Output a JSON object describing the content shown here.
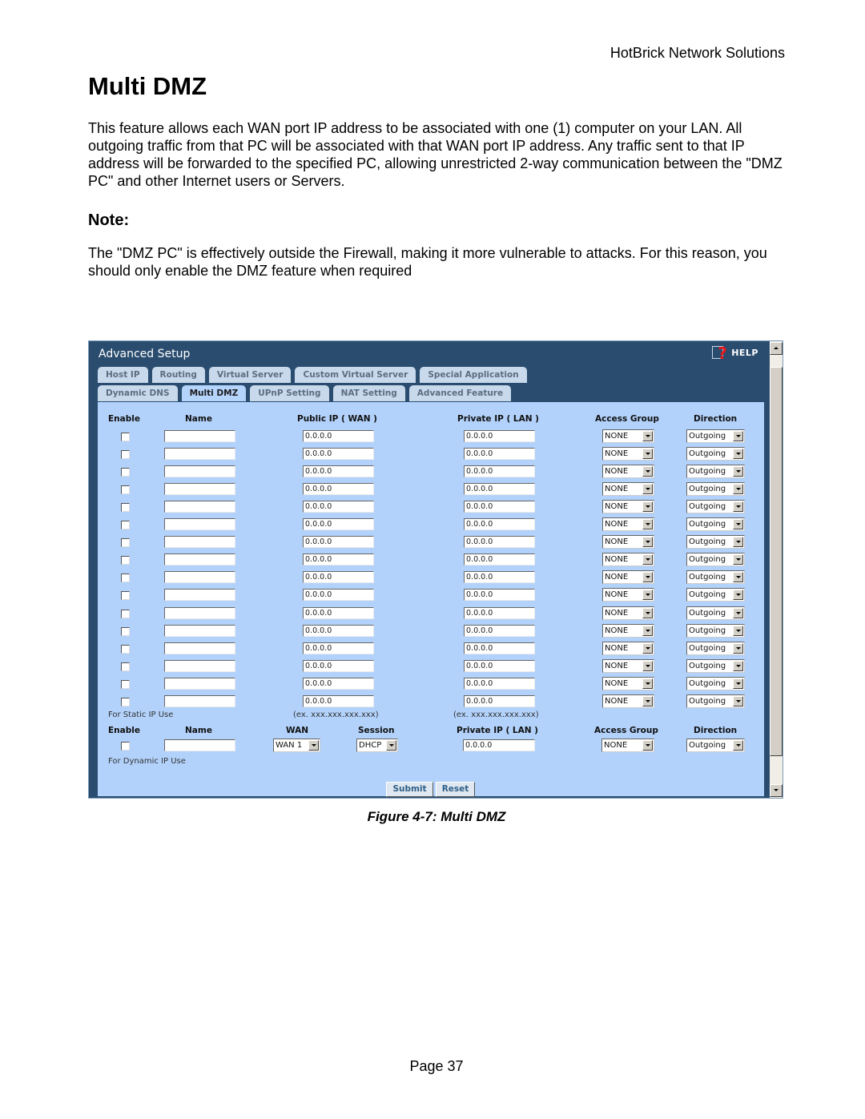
{
  "header": {
    "company": "HotBrick Network Solutions"
  },
  "title": "Multi DMZ",
  "intro": "This feature allows each WAN port IP address to be associated with one (1) computer on your LAN. All outgoing traffic from that PC will be associated with that WAN port IP address. Any traffic sent to that IP address will be forwarded to the specified PC, allowing unrestricted 2-way communication between the \"DMZ PC\" and other Internet users or Servers.",
  "note_heading": "Note:",
  "note_text": "The \"DMZ PC\" is effectively outside the Firewall, making it more vulnerable to attacks. For this reason, you should only enable the DMZ feature when required",
  "figure": {
    "window_title": "Advanced Setup",
    "help_label": "HELP",
    "tabs_row1": [
      "Host IP",
      "Routing",
      "Virtual Server",
      "Custom Virtual Server",
      "Special Application"
    ],
    "tabs_row2": [
      "Dynamic DNS",
      "Multi DMZ",
      "UPnP Setting",
      "NAT Setting",
      "Advanced Feature"
    ],
    "active_tab": "Multi DMZ",
    "static_table": {
      "headers": {
        "enable": "Enable",
        "name": "Name",
        "public_ip": "Public IP ( WAN )",
        "private_ip": "Private IP ( LAN )",
        "access_group": "Access Group",
        "direction": "Direction"
      },
      "rows": [
        {
          "enabled": false,
          "name": "",
          "public_ip": "0.0.0.0",
          "private_ip": "0.0.0.0",
          "access_group": "NONE",
          "direction": "Outgoing"
        },
        {
          "enabled": false,
          "name": "",
          "public_ip": "0.0.0.0",
          "private_ip": "0.0.0.0",
          "access_group": "NONE",
          "direction": "Outgoing"
        },
        {
          "enabled": false,
          "name": "",
          "public_ip": "0.0.0.0",
          "private_ip": "0.0.0.0",
          "access_group": "NONE",
          "direction": "Outgoing"
        },
        {
          "enabled": false,
          "name": "",
          "public_ip": "0.0.0.0",
          "private_ip": "0.0.0.0",
          "access_group": "NONE",
          "direction": "Outgoing"
        },
        {
          "enabled": false,
          "name": "",
          "public_ip": "0.0.0.0",
          "private_ip": "0.0.0.0",
          "access_group": "NONE",
          "direction": "Outgoing"
        },
        {
          "enabled": false,
          "name": "",
          "public_ip": "0.0.0.0",
          "private_ip": "0.0.0.0",
          "access_group": "NONE",
          "direction": "Outgoing"
        },
        {
          "enabled": false,
          "name": "",
          "public_ip": "0.0.0.0",
          "private_ip": "0.0.0.0",
          "access_group": "NONE",
          "direction": "Outgoing"
        },
        {
          "enabled": false,
          "name": "",
          "public_ip": "0.0.0.0",
          "private_ip": "0.0.0.0",
          "access_group": "NONE",
          "direction": "Outgoing"
        },
        {
          "enabled": false,
          "name": "",
          "public_ip": "0.0.0.0",
          "private_ip": "0.0.0.0",
          "access_group": "NONE",
          "direction": "Outgoing"
        },
        {
          "enabled": false,
          "name": "",
          "public_ip": "0.0.0.0",
          "private_ip": "0.0.0.0",
          "access_group": "NONE",
          "direction": "Outgoing"
        },
        {
          "enabled": false,
          "name": "",
          "public_ip": "0.0.0.0",
          "private_ip": "0.0.0.0",
          "access_group": "NONE",
          "direction": "Outgoing"
        },
        {
          "enabled": false,
          "name": "",
          "public_ip": "0.0.0.0",
          "private_ip": "0.0.0.0",
          "access_group": "NONE",
          "direction": "Outgoing"
        },
        {
          "enabled": false,
          "name": "",
          "public_ip": "0.0.0.0",
          "private_ip": "0.0.0.0",
          "access_group": "NONE",
          "direction": "Outgoing"
        },
        {
          "enabled": false,
          "name": "",
          "public_ip": "0.0.0.0",
          "private_ip": "0.0.0.0",
          "access_group": "NONE",
          "direction": "Outgoing"
        },
        {
          "enabled": false,
          "name": "",
          "public_ip": "0.0.0.0",
          "private_ip": "0.0.0.0",
          "access_group": "NONE",
          "direction": "Outgoing"
        },
        {
          "enabled": false,
          "name": "",
          "public_ip": "0.0.0.0",
          "private_ip": "0.0.0.0",
          "access_group": "NONE",
          "direction": "Outgoing"
        }
      ],
      "footer_label": "For Static IP Use",
      "ip_hint": "(ex. xxx.xxx.xxx.xxx)"
    },
    "dynamic_table": {
      "headers": {
        "enable": "Enable",
        "name": "Name",
        "wan": "WAN",
        "session": "Session",
        "private_ip": "Private IP ( LAN )",
        "access_group": "Access Group",
        "direction": "Direction"
      },
      "row": {
        "enabled": false,
        "name": "",
        "wan": "WAN 1",
        "session": "DHCP",
        "private_ip": "0.0.0.0",
        "access_group": "NONE",
        "direction": "Outgoing"
      },
      "footer_label": "For Dynamic IP Use"
    },
    "buttons": {
      "submit": "Submit",
      "reset": "Reset"
    }
  },
  "caption": "Figure 4-7: Multi DMZ",
  "page_number": "Page 37"
}
